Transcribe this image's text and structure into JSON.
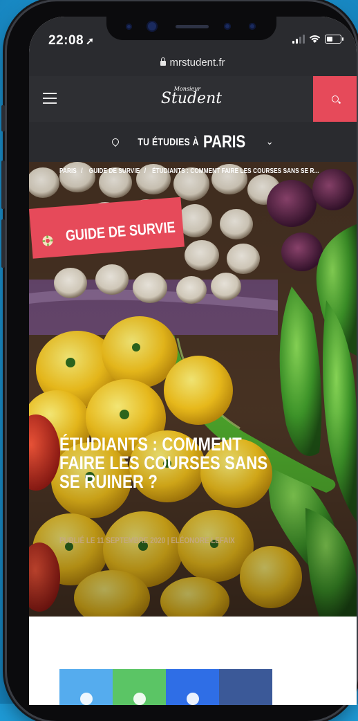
{
  "status": {
    "time": "22:08"
  },
  "browser": {
    "url": "mrstudent.fr"
  },
  "nav": {
    "logo_small": "Monsieur",
    "logo_big": "Student",
    "search_icon": "search-icon",
    "menu_icon": "hamburger-icon"
  },
  "city": {
    "prefix": "TU ÉTUDIES À",
    "name": "PARIS",
    "icon": "location-pin-icon"
  },
  "breadcrumb": [
    {
      "label": "PARIS"
    },
    {
      "label": "GUIDE DE SURVIE"
    },
    {
      "label": "ÉTUDIANTS : COMMENT FAIRE LES COURSES SANS SE R..."
    }
  ],
  "breadcrumb_sep": "/",
  "category": {
    "label": "GUIDE DE SURVIE",
    "icon": "lifebuoy-icon"
  },
  "article": {
    "title": "ÉTUDIANTS : COMMENT FAIRE LES COURSES SANS SE RUINER ?",
    "meta": "PUBLIÉ LE 11 SEPTEMBRE 2020 | ELÉONORE LEFAIX"
  },
  "share": [
    {
      "network": "twitter",
      "color": "#55acee"
    },
    {
      "network": "whatsapp",
      "color": "#5bc565"
    },
    {
      "network": "messenger",
      "color": "#2f6ee6"
    },
    {
      "network": "facebook",
      "color": "#3b5998"
    }
  ],
  "colors": {
    "accent": "#e64a5a",
    "navbar": "#2e2f33",
    "background": "#1e9ad6"
  }
}
